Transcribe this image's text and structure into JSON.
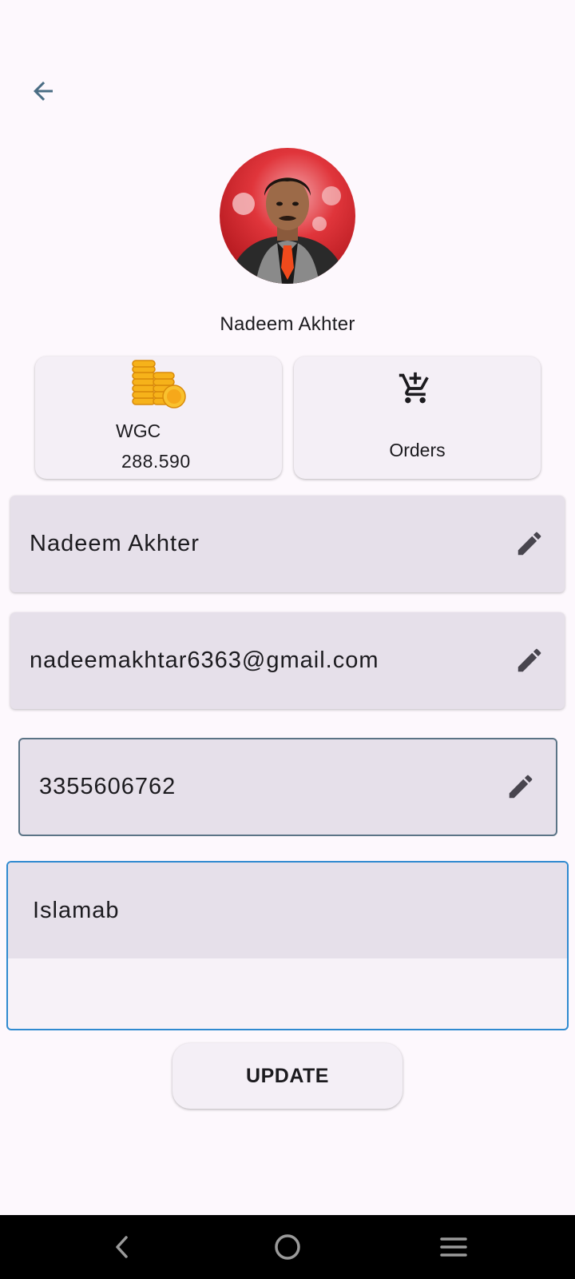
{
  "header": {
    "back_icon": "arrow-back-icon"
  },
  "profile": {
    "name": "Nadeem Akhter",
    "avatar": "profile-photo"
  },
  "stats": {
    "wgc": {
      "label": "WGC",
      "value": "288.590",
      "icon": "coins-icon"
    },
    "orders": {
      "label": "Orders",
      "icon": "add-shopping-cart-icon"
    }
  },
  "form": {
    "name_value": "Nadeem Akhter",
    "email_value": "nadeemakhtar6363@gmail.com",
    "phone_value": "3355606762",
    "address_value": "Islamab",
    "edit_icon": "pencil-icon"
  },
  "actions": {
    "update_label": "UPDATE"
  },
  "nav": {
    "back_icon": "back-chevron-icon",
    "home_icon": "home-circle-icon",
    "menu_icon": "menu-icon"
  },
  "colors": {
    "background": "#fdf8fd",
    "field_fill": "#e6e0ea",
    "card_fill": "#f4eff6",
    "focus_border": "#2f8ad0",
    "back_arrow": "#4a6d84"
  }
}
